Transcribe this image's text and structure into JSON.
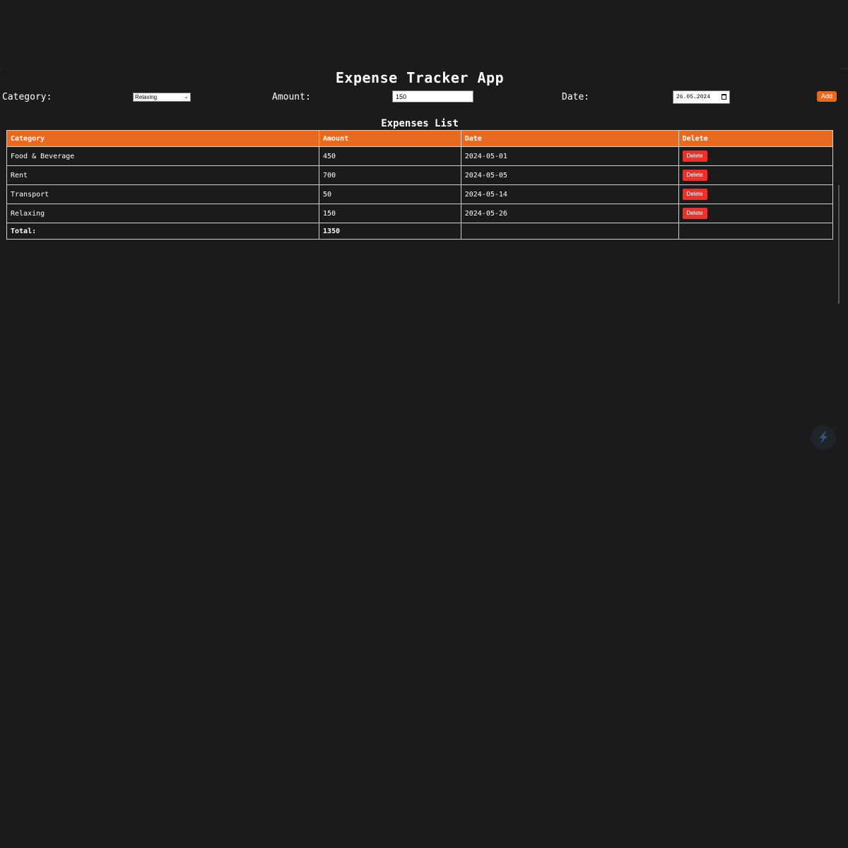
{
  "app": {
    "title": "Expense Tracker App"
  },
  "form": {
    "category_label": "Category:",
    "category_value": "Relaxing",
    "amount_label": "Amount:",
    "amount_value": "150",
    "date_label": "Date:",
    "date_value": "26.05.2024",
    "add_label": "Add"
  },
  "list": {
    "title": "Expenses List",
    "headers": [
      "Category",
      "Amount",
      "Date",
      "Delete"
    ],
    "rows": [
      {
        "category": "Food & Beverage",
        "amount": "450",
        "date": "2024-05-01",
        "delete": "Delete"
      },
      {
        "category": "Rent",
        "amount": "700",
        "date": "2024-05-05",
        "delete": "Delete"
      },
      {
        "category": "Transport",
        "amount": "50",
        "date": "2024-05-14",
        "delete": "Delete"
      },
      {
        "category": "Relaxing",
        "amount": "150",
        "date": "2024-05-26",
        "delete": "Delete"
      }
    ],
    "total_label": "Total:",
    "total_value": "1350"
  },
  "colors": {
    "background": "#1b1b1b",
    "accent": "#e86a1f",
    "delete": "#e5332f"
  },
  "icons": {
    "floating": "lightning-bolt-icon",
    "select_chevron": "chevron-down-icon",
    "calendar": "calendar-icon"
  }
}
